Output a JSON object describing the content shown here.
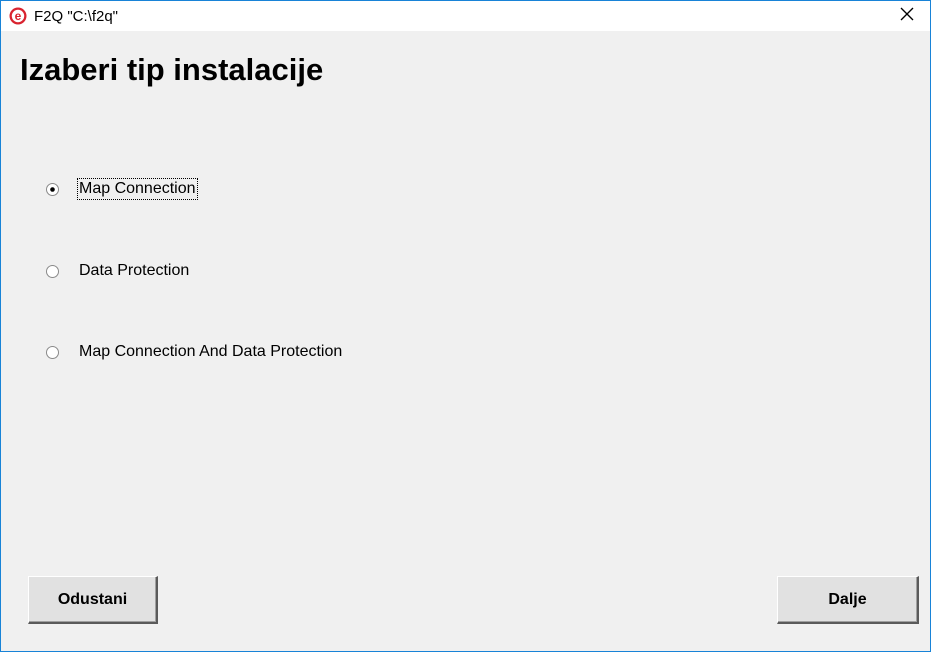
{
  "window": {
    "title": "F2Q \"C:\\f2q\"",
    "app_icon": "e-logo-icon",
    "close_icon": "close-icon"
  },
  "main": {
    "heading": "Izaberi tip instalacije",
    "options": [
      {
        "label": "Map Connection",
        "selected": true
      },
      {
        "label": "Data Protection",
        "selected": false
      },
      {
        "label": "Map Connection And Data Protection",
        "selected": false
      }
    ]
  },
  "buttons": {
    "cancel_label": "Odustani",
    "next_label": "Dalje"
  },
  "colors": {
    "window_border": "#1883d7",
    "background": "#f0f0f0",
    "icon_red": "#d9232f"
  }
}
